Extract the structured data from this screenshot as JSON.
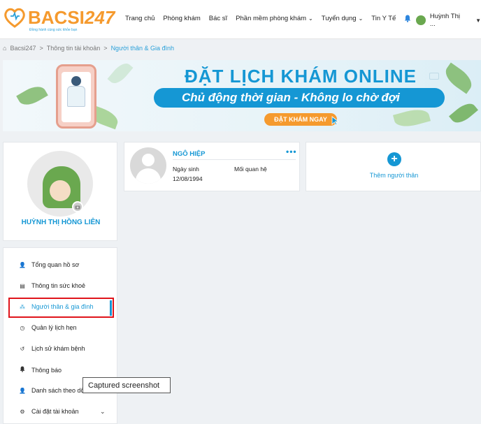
{
  "header": {
    "logo_text": "BACSI",
    "logo_num": "247",
    "logo_tagline": "Đồng hành cùng sức khỏe bạn",
    "nav": [
      {
        "label": "Trang chủ",
        "dropdown": false
      },
      {
        "label": "Phòng khám",
        "dropdown": false
      },
      {
        "label": "Bác sĩ",
        "dropdown": false
      },
      {
        "label": "Phần mềm phòng khám",
        "dropdown": true
      },
      {
        "label": "Tuyển dụng",
        "dropdown": true
      },
      {
        "label": "Tin Y Tế",
        "dropdown": false
      }
    ],
    "user_name": "Huỳnh Thị ...",
    "chevron": "⌄",
    "caret": "▼",
    "bell_icon": "🔔"
  },
  "breadcrumb": {
    "home_icon": "⌂",
    "items": [
      "Bacsi247",
      "Thông tin tài khoản",
      "Người thân & Gia đình"
    ],
    "separator": ">"
  },
  "banner": {
    "headline": "ĐẶT LỊCH KHÁM ONLINE",
    "tagline": "Chủ động thời gian - Không lo chờ đợi",
    "cta": "ĐẶT KHÁM NGAY"
  },
  "profile": {
    "name": "HUỲNH THỊ HỒNG LIÊN",
    "camera_icon": "📷"
  },
  "menu": {
    "items": [
      {
        "label": "Tổng quan hồ sơ",
        "icon": "user-icon",
        "glyph": "👤"
      },
      {
        "label": "Thông tin sức khoẻ",
        "icon": "health-record-icon",
        "glyph": "▤"
      },
      {
        "label": "Người thân & gia đình",
        "icon": "family-icon",
        "glyph": "⁂"
      },
      {
        "label": "Quản lý lịch hẹn",
        "icon": "clock-icon",
        "glyph": "◷"
      },
      {
        "label": "Lịch sử khám bệnh",
        "icon": "history-icon",
        "glyph": "↺"
      },
      {
        "label": "Thông báo",
        "icon": "bell-icon",
        "glyph": "🔔"
      },
      {
        "label": "Danh sách theo dõi",
        "icon": "follow-icon",
        "glyph": "👤"
      },
      {
        "label": "Cài đặt tài khoản",
        "icon": "settings-icon",
        "glyph": "⚙"
      }
    ],
    "active_index": 2,
    "settings_chevron": "⌄"
  },
  "relative": {
    "name": "NGÔ HIỆP",
    "more": "•••",
    "dob_label": "Ngày sinh",
    "dob_value": "12/08/1994",
    "relationship_label": "Mối quan hệ"
  },
  "add_relative": {
    "icon": "+",
    "label": "Thêm người thân"
  },
  "tooltip": {
    "text": "Captured screenshot"
  },
  "colors": {
    "accent": "#1597d4",
    "brand_orange": "#f59a2e",
    "highlight_red": "#e0141b"
  }
}
